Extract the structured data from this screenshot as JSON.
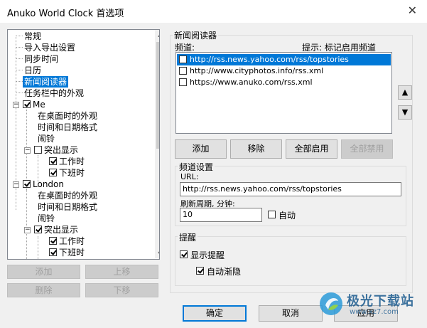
{
  "window": {
    "title": "Anuko World Clock 首选项"
  },
  "tree": {
    "items": [
      {
        "label": "常规"
      },
      {
        "label": "导入导出设置"
      },
      {
        "label": "同步时间"
      },
      {
        "label": "日历"
      },
      {
        "label": "新闻阅读器",
        "selected": true
      },
      {
        "label": "任务栏中的外观"
      },
      {
        "label": "Me",
        "checked": true
      },
      {
        "label": "在桌面时的外观"
      },
      {
        "label": "时间和日期格式"
      },
      {
        "label": "闹铃"
      },
      {
        "label": "突出显示",
        "checked": false
      },
      {
        "label": "工作时",
        "checked": true
      },
      {
        "label": "下班时",
        "checked": true
      },
      {
        "label": "London",
        "checked": true
      },
      {
        "label": "在桌面时的外观"
      },
      {
        "label": "时间和日期格式"
      },
      {
        "label": "闹铃"
      },
      {
        "label": "突出显示",
        "checked": true
      },
      {
        "label": "工作时",
        "checked": true
      },
      {
        "label": "下班时",
        "checked": true
      }
    ]
  },
  "left_buttons": {
    "add": "添加",
    "move_up": "上移",
    "delete": "删除",
    "move_down": "下移"
  },
  "newsreader": {
    "group_label": "新闻阅读器",
    "feeds_label": "频道:",
    "hint": "提示: 标记启用频道",
    "feeds": [
      {
        "url": "http://rss.news.yahoo.com/rss/topstories",
        "checked": false,
        "selected": true
      },
      {
        "url": "http://www.cityphotos.info/rss.xml",
        "checked": false
      },
      {
        "url": "https://www.anuko.com/rss.xml",
        "checked": false
      }
    ],
    "buttons": {
      "add": "添加",
      "remove": "移除",
      "enable_all": "全部启用",
      "disable_all": "全部禁用"
    }
  },
  "channel_settings": {
    "group_label": "频道设置",
    "url_label": "URL:",
    "url_value": "http://rss.news.yahoo.com/rss/topstories",
    "refresh_label": "刷新周期, 分钟:",
    "refresh_value": "10",
    "auto_label": "自动",
    "auto_checked": false
  },
  "reminder": {
    "group_label": "提醒",
    "show_label": "显示提醒",
    "show_checked": true,
    "autohide_label": "自动渐隐",
    "autohide_checked": true
  },
  "dialog_buttons": {
    "ok": "确定",
    "cancel": "取消",
    "apply": "应用"
  },
  "watermark": {
    "brand": "极光下载站",
    "url": "www.xz7.com"
  }
}
